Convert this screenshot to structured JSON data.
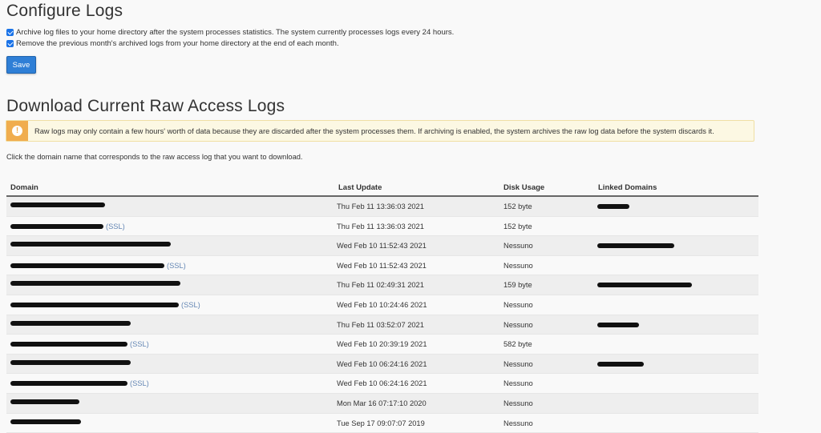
{
  "configure": {
    "title": "Configure Logs",
    "option_archive": "Archive log files to your home directory after the system processes statistics. The system currently processes logs every 24 hours.",
    "option_remove": "Remove the previous month's archived logs from your home directory at the end of each month.",
    "save_label": "Save"
  },
  "download": {
    "title": "Download Current Raw Access Logs",
    "alert_icon": "!",
    "alert_text": "Raw logs may only contain a few hours' worth of data because they are discarded after the system processes them. If archiving is enabled, the system archives the raw log data before the system discards it.",
    "intro": "Click the domain name that corresponds to the raw access log that you want to download."
  },
  "table": {
    "headers": [
      "Domain",
      "Last Update",
      "Disk Usage",
      "Linked Domains"
    ],
    "rows": [
      {
        "ssl": "",
        "last_update": "Thu Feb 11 13:36:03 2021",
        "disk_usage": "152 byte"
      },
      {
        "ssl": "(SSL)",
        "last_update": "Thu Feb 11 13:36:03 2021",
        "disk_usage": "152 byte"
      },
      {
        "ssl": "",
        "last_update": "Wed Feb 10 11:52:43 2021",
        "disk_usage": "Nessuno"
      },
      {
        "ssl": "(SSL)",
        "last_update": "Wed Feb 10 11:52:43 2021",
        "disk_usage": "Nessuno"
      },
      {
        "ssl": "",
        "last_update": "Thu Feb 11 02:49:31 2021",
        "disk_usage": "159 byte"
      },
      {
        "ssl": "(SSL)",
        "last_update": "Wed Feb 10 10:24:46 2021",
        "disk_usage": "Nessuno"
      },
      {
        "ssl": "",
        "last_update": "Thu Feb 11 03:52:07 2021",
        "disk_usage": "Nessuno"
      },
      {
        "ssl": "(SSL)",
        "last_update": "Wed Feb 10 20:39:19 2021",
        "disk_usage": "582 byte"
      },
      {
        "ssl": "",
        "last_update": "Wed Feb 10 06:24:16 2021",
        "disk_usage": "Nessuno"
      },
      {
        "ssl": "(SSL)",
        "last_update": "Wed Feb 10 06:24:16 2021",
        "disk_usage": "Nessuno"
      },
      {
        "ssl": "",
        "last_update": "Mon Mar 16 07:17:10 2020",
        "disk_usage": "Nessuno"
      },
      {
        "ssl": "",
        "last_update": "Tue Sep 17 09:07:07 2019",
        "disk_usage": "Nessuno"
      }
    ]
  }
}
